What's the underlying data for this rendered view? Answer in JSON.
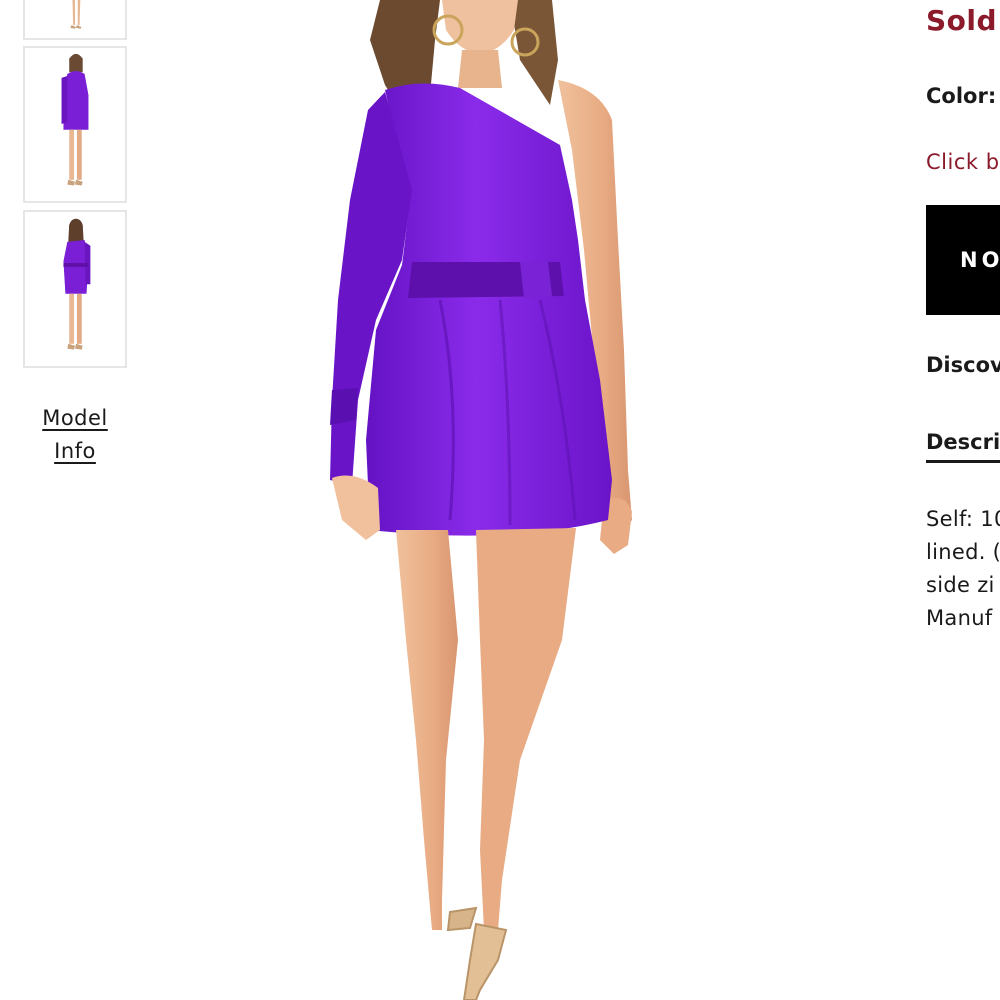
{
  "thumbnails": [
    {
      "view": "front"
    },
    {
      "view": "side"
    },
    {
      "view": "back"
    }
  ],
  "model_info": {
    "line1": "Model",
    "line2": "Info"
  },
  "main_image": {
    "alt": "Model wearing a purple one-shoulder satin mini dress"
  },
  "product": {
    "status": "Sold",
    "color_label": "Color:",
    "click_text": "Click b",
    "notify_button": "NO",
    "discover_label": "Discov",
    "description_tab": "Descri",
    "description_lines": [
      "Self: 10",
      "lined. (",
      "side zi",
      "Manuf"
    ]
  },
  "colors": {
    "dress": "#7a1fd6",
    "accent": "#8b1a2b",
    "button_bg": "#000000"
  }
}
